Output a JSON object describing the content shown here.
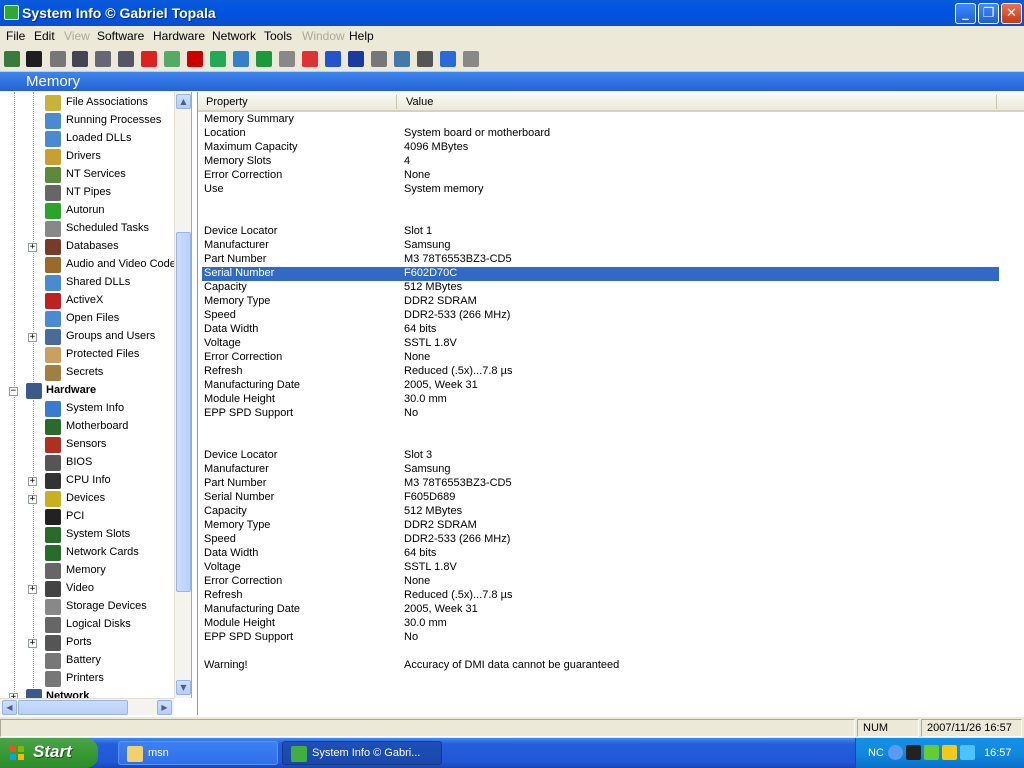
{
  "window": {
    "title": "System Info  © Gabriel Topala"
  },
  "menu": [
    {
      "label": "File",
      "enabled": true
    },
    {
      "label": "Edit",
      "enabled": true
    },
    {
      "label": "View",
      "enabled": false
    },
    {
      "label": "Software",
      "enabled": true
    },
    {
      "label": "Hardware",
      "enabled": true
    },
    {
      "label": "Network",
      "enabled": true
    },
    {
      "label": "Tools",
      "enabled": true
    },
    {
      "label": "Window",
      "enabled": false
    },
    {
      "label": "Help",
      "enabled": true
    }
  ],
  "toolbar": {
    "icons": [
      "exit-icon",
      "save-icon",
      "cut-icon",
      "copy-icon",
      "paste-icon",
      "print-icon",
      "stop-icon",
      "report-icon",
      "color-icon",
      "chart-icon",
      "globe-icon",
      "refresh-icon",
      "document-icon",
      "clock-icon",
      "navigate-icon",
      "shield-icon",
      "table-icon",
      "earth-icon",
      "disk-icon",
      "help-icon",
      "settings-icon"
    ]
  },
  "section": {
    "title": "Memory"
  },
  "tree": {
    "items": [
      {
        "label": "File Associations"
      },
      {
        "label": "Running Processes"
      },
      {
        "label": "Loaded DLLs"
      },
      {
        "label": "Drivers"
      },
      {
        "label": "NT Services"
      },
      {
        "label": "NT Pipes"
      },
      {
        "label": "Autorun"
      },
      {
        "label": "Scheduled Tasks"
      },
      {
        "label": "Databases"
      },
      {
        "label": "Audio and Video Codecs"
      },
      {
        "label": "Shared DLLs"
      },
      {
        "label": "ActiveX"
      },
      {
        "label": "Open Files"
      },
      {
        "label": "Groups and Users"
      },
      {
        "label": "Protected Files"
      },
      {
        "label": "Secrets"
      },
      {
        "label": "Hardware"
      },
      {
        "label": "System Info"
      },
      {
        "label": "Motherboard"
      },
      {
        "label": "Sensors"
      },
      {
        "label": "BIOS"
      },
      {
        "label": "CPU Info"
      },
      {
        "label": "Devices"
      },
      {
        "label": "PCI"
      },
      {
        "label": "System Slots"
      },
      {
        "label": "Network Cards"
      },
      {
        "label": "Memory"
      },
      {
        "label": "Video"
      },
      {
        "label": "Storage Devices"
      },
      {
        "label": "Logical Disks"
      },
      {
        "label": "Ports"
      },
      {
        "label": "Battery"
      },
      {
        "label": "Printers"
      },
      {
        "label": "Network"
      }
    ]
  },
  "list": {
    "columns": [
      "Property",
      "Value"
    ],
    "rows": [
      {
        "property": "Memory Summary",
        "value": ""
      },
      {
        "property": "Location",
        "value": "System board or motherboard"
      },
      {
        "property": "Maximum Capacity",
        "value": "4096 MBytes"
      },
      {
        "property": "Memory Slots",
        "value": "4"
      },
      {
        "property": "Error Correction",
        "value": "None"
      },
      {
        "property": "Use",
        "value": "System memory"
      },
      {
        "property": "",
        "value": ""
      },
      {
        "property": "",
        "value": ""
      },
      {
        "property": "Device Locator",
        "value": "Slot 1"
      },
      {
        "property": "Manufacturer",
        "value": "Samsung"
      },
      {
        "property": "Part Number",
        "value": "M3 78T6553BZ3-CD5"
      },
      {
        "property": "Serial Number",
        "value": "F602D70C",
        "selected": true
      },
      {
        "property": "Capacity",
        "value": "512 MBytes"
      },
      {
        "property": "Memory Type",
        "value": "DDR2 SDRAM"
      },
      {
        "property": "Speed",
        "value": "DDR2-533 (266 MHz)"
      },
      {
        "property": "Data Width",
        "value": "64 bits"
      },
      {
        "property": "Voltage",
        "value": "SSTL 1.8V"
      },
      {
        "property": "Error Correction",
        "value": "None"
      },
      {
        "property": "Refresh",
        "value": "Reduced (.5x)...7.8 µs"
      },
      {
        "property": "Manufacturing Date",
        "value": "2005, Week 31"
      },
      {
        "property": "Module Height",
        "value": "30.0 mm"
      },
      {
        "property": "EPP SPD Support",
        "value": "No"
      },
      {
        "property": "",
        "value": ""
      },
      {
        "property": "",
        "value": ""
      },
      {
        "property": "Device Locator",
        "value": "Slot 3"
      },
      {
        "property": "Manufacturer",
        "value": "Samsung"
      },
      {
        "property": "Part Number",
        "value": "M3 78T6553BZ3-CD5"
      },
      {
        "property": "Serial Number",
        "value": "F605D689"
      },
      {
        "property": "Capacity",
        "value": "512 MBytes"
      },
      {
        "property": "Memory Type",
        "value": "DDR2 SDRAM"
      },
      {
        "property": "Speed",
        "value": "DDR2-533 (266 MHz)"
      },
      {
        "property": "Data Width",
        "value": "64 bits"
      },
      {
        "property": "Voltage",
        "value": "SSTL 1.8V"
      },
      {
        "property": "Error Correction",
        "value": "None"
      },
      {
        "property": "Refresh",
        "value": "Reduced (.5x)...7.8 µs"
      },
      {
        "property": "Manufacturing Date",
        "value": "2005, Week 31"
      },
      {
        "property": "Module Height",
        "value": "30.0 mm"
      },
      {
        "property": "EPP SPD Support",
        "value": "No"
      },
      {
        "property": "",
        "value": ""
      },
      {
        "property": "Warning!",
        "value": "Accuracy of DMI data cannot be guaranteed"
      }
    ]
  },
  "status": {
    "num": "NUM",
    "datetime": "2007/11/26 16:57"
  },
  "taskbar": {
    "start_label": "Start",
    "tasks": [
      {
        "label": "msn",
        "icon": "folder-icon",
        "active": false
      },
      {
        "label": "System Info  © Gabri...",
        "icon": "systeminfo-icon",
        "active": true
      }
    ],
    "tray": {
      "text": "NC",
      "clock": "16:57"
    }
  },
  "colors": {
    "titlebar": "#0054e3",
    "selection": "#316ac5",
    "taskbar": "#245edb",
    "start": "#379b33"
  }
}
